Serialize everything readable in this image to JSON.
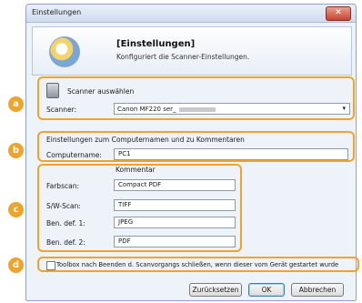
{
  "window": {
    "title": "Einstellungen",
    "close_glyph": "✕"
  },
  "header": {
    "title": "[Einstellungen]",
    "subtitle": "Konfiguriert die Scanner-Einstellungen.",
    "icon": "scanner-settings-icon"
  },
  "badges": {
    "a": "a",
    "b": "b",
    "c": "c",
    "d": "d"
  },
  "scanner_section": {
    "heading": "Scanner auswählen",
    "label": "Scanner:",
    "selected": "Canon MF220 ser_",
    "icon": "scanner-icon"
  },
  "computer_section": {
    "heading": "Einstellungen zum Computernamen und zu Kommentaren",
    "name_label": "Computername:",
    "name_value": "PC1"
  },
  "comments": {
    "column_header": "Kommentar",
    "rows": [
      {
        "label": "Farbscan:",
        "value": "Compact PDF"
      },
      {
        "label": "S/W-Scan:",
        "value": "TIFF"
      },
      {
        "label": "Ben. def. 1:",
        "value": "JPEG"
      },
      {
        "label": "Ben. def. 2:",
        "value": "PDF"
      }
    ]
  },
  "toolbox_option": {
    "label": "Toolbox nach Beenden d. Scanvorgangs schließen, wenn dieser vom Gerät gestartet wurde",
    "checked": false
  },
  "buttons": {
    "reset": "Zurücksetzen",
    "ok": "OK",
    "cancel": "Abbrechen"
  },
  "colors": {
    "accent": "#f0a32b",
    "window_bg": "#eef3fa"
  }
}
